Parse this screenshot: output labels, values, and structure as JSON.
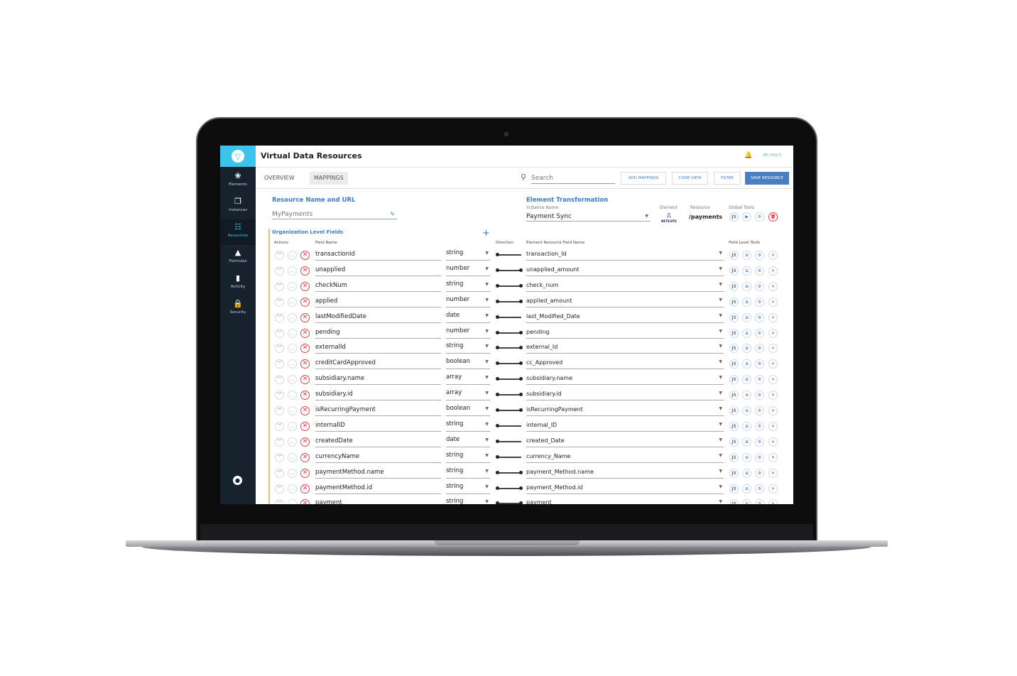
{
  "app": {
    "title": "Virtual Data Resources",
    "api_docs": "API DOCS"
  },
  "sidebar": {
    "items": [
      {
        "label": "Elements",
        "icon": "elements-icon",
        "glyph": "❀"
      },
      {
        "label": "Instances",
        "icon": "instances-icon",
        "glyph": "❐"
      },
      {
        "label": "Resources",
        "icon": "resources-icon",
        "glyph": "☷",
        "active": true
      },
      {
        "label": "Formulas",
        "icon": "flask-icon",
        "glyph": "▲"
      },
      {
        "label": "Activity",
        "icon": "bar-chart-icon",
        "glyph": "▮"
      },
      {
        "label": "Security",
        "icon": "lock-icon",
        "glyph": "🔒"
      }
    ]
  },
  "tabs": [
    {
      "label": "OVERVIEW"
    },
    {
      "label": "MAPPINGS",
      "selected": true
    }
  ],
  "toolbar": {
    "search_placeholder": "Search",
    "add_mappings": "ADD MAPPINGS",
    "code_view": "CODE VIEW",
    "filter": "FILTER",
    "save_resource": "SAVE RESOURCE"
  },
  "resource": {
    "heading": "Resource Name and URL",
    "name": "MyPayments"
  },
  "transformation": {
    "heading": "Element Transformation",
    "instance_label": "Instance Name",
    "instance_value": "Payment Sync",
    "element_label": "Element",
    "element_logo": "NETSUITE",
    "resource_label": "Resource",
    "resource_value": "/payments",
    "global_tools_label": "Global Tools",
    "js": "JS"
  },
  "org": {
    "heading": "Organization Level Fields",
    "columns": {
      "actions": "Actions",
      "field_name": "Field Name",
      "direction": "Direction",
      "element_field": "Element Resource Field Name",
      "tools": "Field Level Tools"
    }
  },
  "colors": {
    "accent": "#3d7cc9",
    "logo": "#3cc3ee",
    "sidebar": "#18222f",
    "delete": "#e8404a"
  },
  "rows": [
    {
      "field": "transactionId",
      "type": "string",
      "direction": "one-way",
      "element_field": "transaction_Id"
    },
    {
      "field": "unapplied",
      "type": "number",
      "direction": "two-way",
      "element_field": "unapplied_amount"
    },
    {
      "field": "checkNum",
      "type": "string",
      "direction": "two-way",
      "element_field": "check_num"
    },
    {
      "field": "applied",
      "type": "number",
      "direction": "two-way",
      "element_field": "applied_amount"
    },
    {
      "field": "lastModifiedDate",
      "type": "date",
      "direction": "one-way",
      "element_field": "last_Modified_Date"
    },
    {
      "field": "pending",
      "type": "number",
      "direction": "two-way",
      "element_field": "pending"
    },
    {
      "field": "externalId",
      "type": "string",
      "direction": "two-way",
      "element_field": "external_Id"
    },
    {
      "field": "creditCardApproved",
      "type": "boolean",
      "direction": "two-way",
      "element_field": "cc_Approved"
    },
    {
      "field": "subsidiary.name",
      "type": "array",
      "direction": "two-way",
      "element_field": "subsidiary.name"
    },
    {
      "field": "subsidiary.id",
      "type": "array",
      "direction": "two-way",
      "element_field": "subsidiary.id"
    },
    {
      "field": "isRecurringPayment",
      "type": "boolean",
      "direction": "two-way",
      "element_field": "isRecurringPayment"
    },
    {
      "field": "internalID",
      "type": "string",
      "direction": "one-way",
      "element_field": "internal_ID"
    },
    {
      "field": "createdDate",
      "type": "date",
      "direction": "one-way",
      "element_field": "created_Date"
    },
    {
      "field": "currencyName",
      "type": "string",
      "direction": "one-way",
      "element_field": "currency_Name"
    },
    {
      "field": "paymentMethod.name",
      "type": "string",
      "direction": "two-way",
      "element_field": "payment_Method.name"
    },
    {
      "field": "paymentMethod.id",
      "type": "string",
      "direction": "two-way",
      "element_field": "payment_Method.id"
    },
    {
      "field": "payment",
      "type": "string",
      "direction": "two-way",
      "element_field": "payment"
    }
  ]
}
